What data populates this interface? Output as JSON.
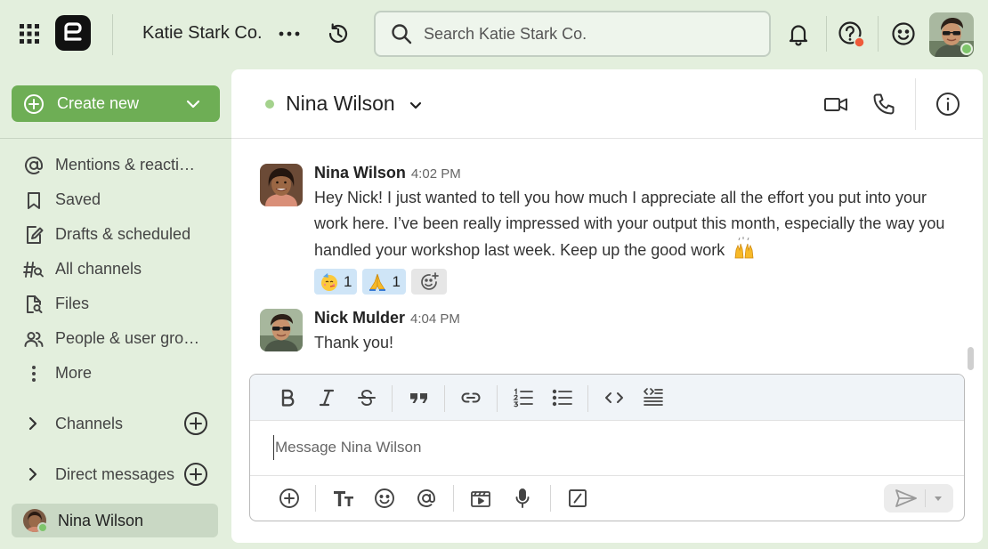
{
  "topbar": {
    "workspace_name": "Katie Stark Co.",
    "search_placeholder": "Search Katie Stark Co.",
    "notification_color": "#ef5b3a",
    "presence_color": "#7ec56b"
  },
  "sidebar": {
    "create_label": "Create new",
    "nav_items": [
      {
        "label": "Mentions & reacti…",
        "icon": "at-icon"
      },
      {
        "label": "Saved",
        "icon": "bookmark-icon"
      },
      {
        "label": "Drafts & scheduled",
        "icon": "draft-edit-icon"
      },
      {
        "label": "All channels",
        "icon": "channel-search-icon"
      },
      {
        "label": "Files",
        "icon": "file-search-icon"
      },
      {
        "label": "People & user gro…",
        "icon": "people-icon"
      },
      {
        "label": "More",
        "icon": "more-vertical-icon"
      }
    ],
    "sections": {
      "channels": "Channels",
      "direct_messages": "Direct messages"
    },
    "active_dm": "Nina Wilson"
  },
  "chat": {
    "title": "Nina Wilson",
    "messages": [
      {
        "author": "Nina Wilson",
        "time": "4:02 PM",
        "text": "Hey Nick! I just wanted to tell you how much I appreciate all the effort you put into your work here. I’ve been really impressed with your output this month, especially the way you handled your workshop last week. Keep up the good work",
        "emoji": "raising-hands",
        "reactions": [
          {
            "emoji": "partying-face",
            "count": "1"
          },
          {
            "emoji": "folded-hands",
            "count": "1"
          }
        ]
      },
      {
        "author": "Nick Mulder",
        "time": "4:04 PM",
        "text": "Thank you!"
      }
    ]
  },
  "composer": {
    "placeholder": "Message Nina Wilson",
    "format_buttons": [
      "bold",
      "italic",
      "strikethrough",
      "quote",
      "link",
      "numbered-list",
      "bulleted-list",
      "code",
      "code-block"
    ],
    "action_buttons": [
      "add",
      "text-format",
      "emoji",
      "mention",
      "video-clip",
      "audio-clip",
      "slash-command"
    ]
  },
  "colors": {
    "background": "#e3efdd",
    "primary_button": "#6eae55",
    "reaction_bg": "#cfe5f7",
    "active_item_bg": "#c9d8c4"
  }
}
